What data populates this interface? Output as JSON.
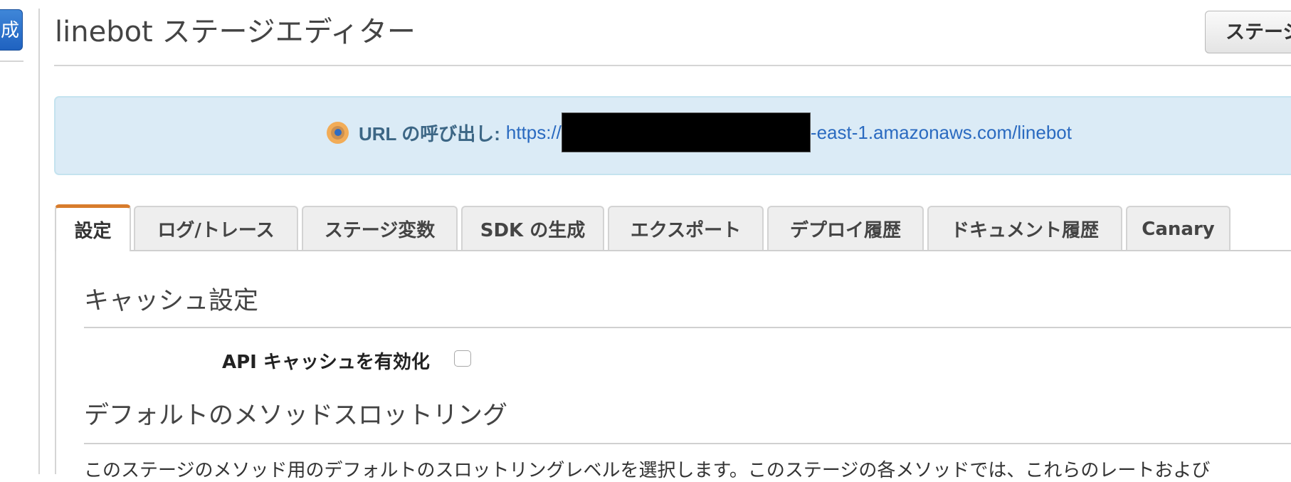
{
  "nav": {
    "left_button_label": "成"
  },
  "header": {
    "title": "linebot ステージエディター",
    "stage_button_label": "ステージ"
  },
  "invoke_url": {
    "icon": "info-dot-icon",
    "label": "URL の呼び出し:",
    "url_prefix": "https://",
    "url_suffix": "-east-1.amazonaws.com/linebot",
    "redacted": true,
    "colors": {
      "box_background": "#dbebf6",
      "label": "#3c6685",
      "link": "#2a6ac0",
      "icon": "#f2ac57"
    }
  },
  "tabs": [
    {
      "label": "設定",
      "active": true
    },
    {
      "label": "ログ/トレース",
      "active": false
    },
    {
      "label": "ステージ変数",
      "active": false
    },
    {
      "label": "SDK の生成",
      "active": false
    },
    {
      "label": "エクスポート",
      "active": false
    },
    {
      "label": "デプロイ履歴",
      "active": false
    },
    {
      "label": "ドキュメント履歴",
      "active": false
    },
    {
      "label": "Canary",
      "active": false
    }
  ],
  "active_tab_accent": "#d87c2c",
  "cache_settings": {
    "title": "キャッシュ設定",
    "enable_label": "API キャッシュを有効化",
    "enabled": false
  },
  "throttling": {
    "title": "デフォルトのメソッドスロットリング",
    "description": "このステージのメソッド用のデフォルトのスロットリングレベルを選択します。このステージの各メソッドでは、これらのレートおよび"
  }
}
